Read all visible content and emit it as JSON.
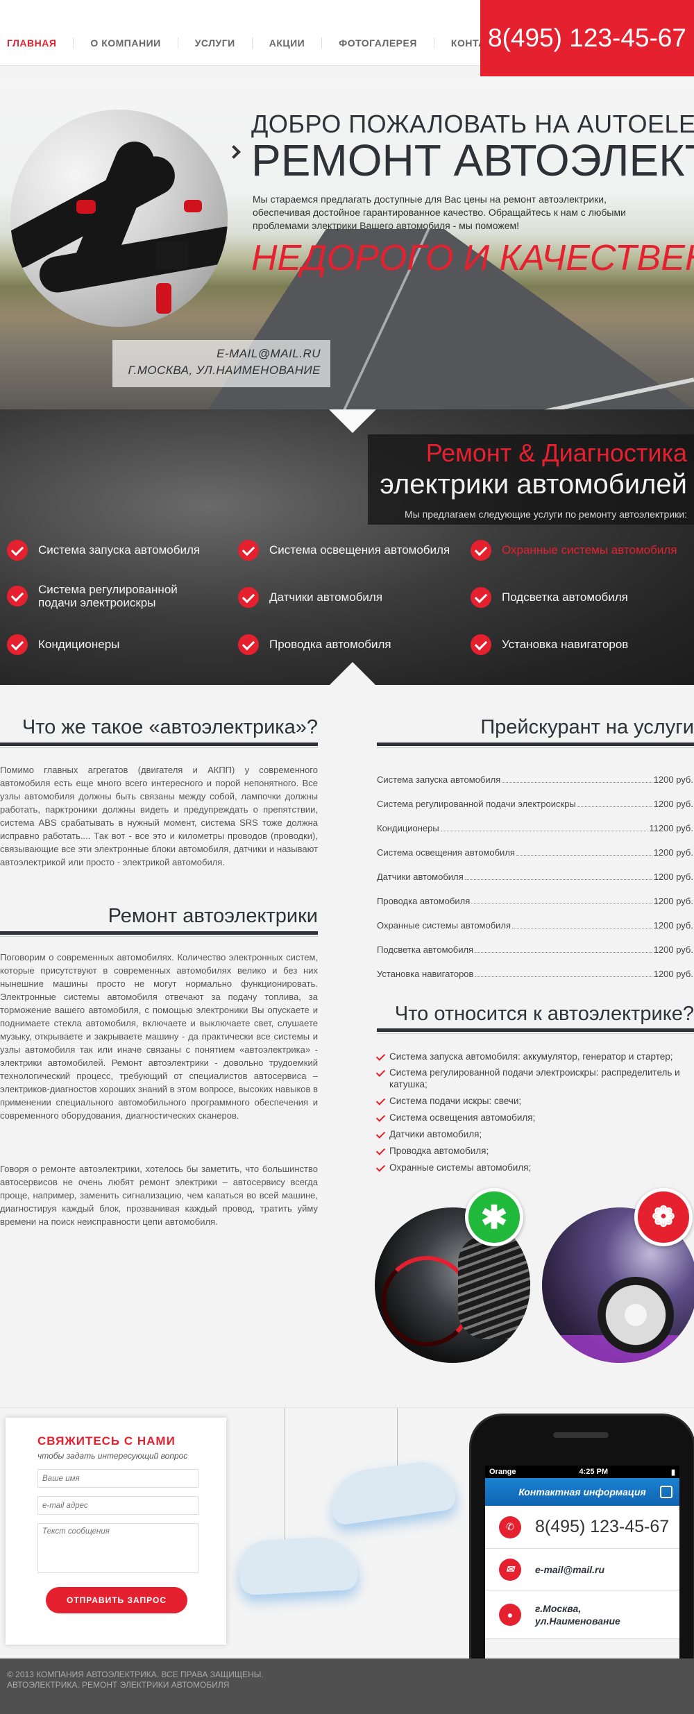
{
  "nav": {
    "items": [
      "Главная",
      "О компании",
      "Услуги",
      "Акции",
      "Фотогалерея",
      "Контакты"
    ],
    "phone": "8(495) 123-45-67"
  },
  "hero": {
    "welcome": "ДОБРО ПОЖАЛОВАТЬ НА AUTOELEKTRIK.RU",
    "title": "РЕМОНТ АВТОЭЛЕКТРИКИ",
    "description": "Мы стараемся предлагать доступные для Вас цены на ремонт автоэлектрики, обеспечивая достойное гарантированное качество. Обращайтесь к нам с любыми проблемами электрики Вашего автомобиля - мы поможем!",
    "slogan": "НЕДОРОГО И КАЧЕСТВЕННО!",
    "email": "E-MAIL@MAIL.RU",
    "address": "Г.МОСКВА, УЛ.НАИМЕНОВАНИЕ"
  },
  "services": {
    "title_accent": "Ремонт & Диагностика",
    "title_main": "электрики автомобилей",
    "subtitle": "Мы предлагаем следующие услуги по ремонту автоэлектрики:",
    "items": [
      "Система запуска автомобиля",
      "Система освещения автомобиля",
      "Охранные системы автомобиля",
      "Система регулированной подачи электроискры",
      "Датчики автомобиля",
      "Подсветка автомобиля",
      "Кондиционеры",
      "Проводка автомобиля",
      "Установка навигаторов"
    ],
    "accent_color": "#e5202f"
  },
  "about": {
    "title": "Что же такое «автоэлектрика»?",
    "text": "Помимо главных агрегатов (двигателя и АКПП) у современного автомобиля есть еще много всего интересного и порой непонятного. Все узлы автомобиля должны быть связаны между собой, лампочки должны работать, парктроники должны видеть и предупреждать о препятствии, система ABS срабатывать в нужный момент, система SRS тоже должна исправно работать.... Так вот - все это и километры проводов (проводки), связывающие все эти электронные блоки автомобиля, датчики и называют автоэлектрикой или просто - электрикой автомобиля."
  },
  "repair": {
    "title": "Ремонт автоэлектрики",
    "text1": "Поговорим о современных автомобилях. Количество электронных систем, которые присутствуют в современных автомобилях велико и без них нынешние машины просто не могут нормально функционировать. Электронные системы автомобиля отвечают за подачу топлива, за торможение вашего автомобиля, с помощью электроники Вы опускаете и поднимаете стекла автомобиля, включаете и выключаете свет, слушаете музыку, открываете и закрываете машину - да практически все системы и узлы автомобиля так или иначе связаны с понятием «автоэлектрика» - электрики автомобилей. Ремонт автоэлектрики - довольно трудоемкий технологический процесс, требующий от специалистов автосервиса – электриков-диагностов хороших знаний в этом вопросе, высоких навыков в применении специального автомобильного программного обеспечения и современного оборудования, диагностических сканеров.",
    "text2": "Говоря о ремонте автоэлектрики, хотелось бы заметить, что большинство автосервисов не очень любят ремонт электрики – автосервису всегда проще, например, заменить сигнализацию, чем капаться во всей машине, диагностируя каждый блок, прозванивая каждый провод, тратить уйму времени на поиск неисправности цепи автомобиля."
  },
  "prices": {
    "title": "Прейскурант на услуги",
    "rows": [
      {
        "name": "Система запуска автомобиля",
        "price": "1200 руб."
      },
      {
        "name": "Система регулированной подачи электроискры",
        "price": "1200 руб."
      },
      {
        "name": "Кондиционеры",
        "price": "11200 руб."
      },
      {
        "name": "Система освещения автомобиля",
        "price": "1200 руб."
      },
      {
        "name": "Датчики автомобиля",
        "price": "1200 руб."
      },
      {
        "name": "Проводка автомобиля",
        "price": "1200 руб."
      },
      {
        "name": "Охранные системы автомобиля",
        "price": "1200 руб."
      },
      {
        "name": "Подсветка автомобиля",
        "price": "1200 руб."
      },
      {
        "name": "Установка навигаторов",
        "price": "1200 руб."
      }
    ]
  },
  "relates": {
    "title": "Что относится к автоэлектрике?",
    "items": [
      "Система запуска автомобиля: аккумулятор, генератор и стартер;",
      "Система регулированной подачи электроискры: распределитель и катушка;",
      "Система подачи искры: свечи;",
      "Система освещения автомобиля;",
      "Датчики автомобиля;",
      "Проводка автомобиля;",
      "Охранные системы автомобиля;"
    ]
  },
  "contact": {
    "title": "СВЯЖИТЕСЬ С НАМИ",
    "subtitle": "чтобы задать интересующий вопрос",
    "name_placeholder": "Ваше имя",
    "email_placeholder": "e-mail адрес",
    "message_placeholder": "Текст сообщения",
    "send": "ОТПРАВИТЬ ЗАПРОС"
  },
  "phone_card": {
    "carrier": "Orange",
    "time": "4:25 PM",
    "header": "Контактная информация",
    "phone": "8(495) 123-45-67",
    "email": "e-mail@mail.ru",
    "address": "г.Москва, ул.Наименование"
  },
  "footer": {
    "line1": "© 2013 компания автоэлектрика. все права защищены.",
    "line2": "автоэлектрика. ремонт электрики автомобиля"
  }
}
